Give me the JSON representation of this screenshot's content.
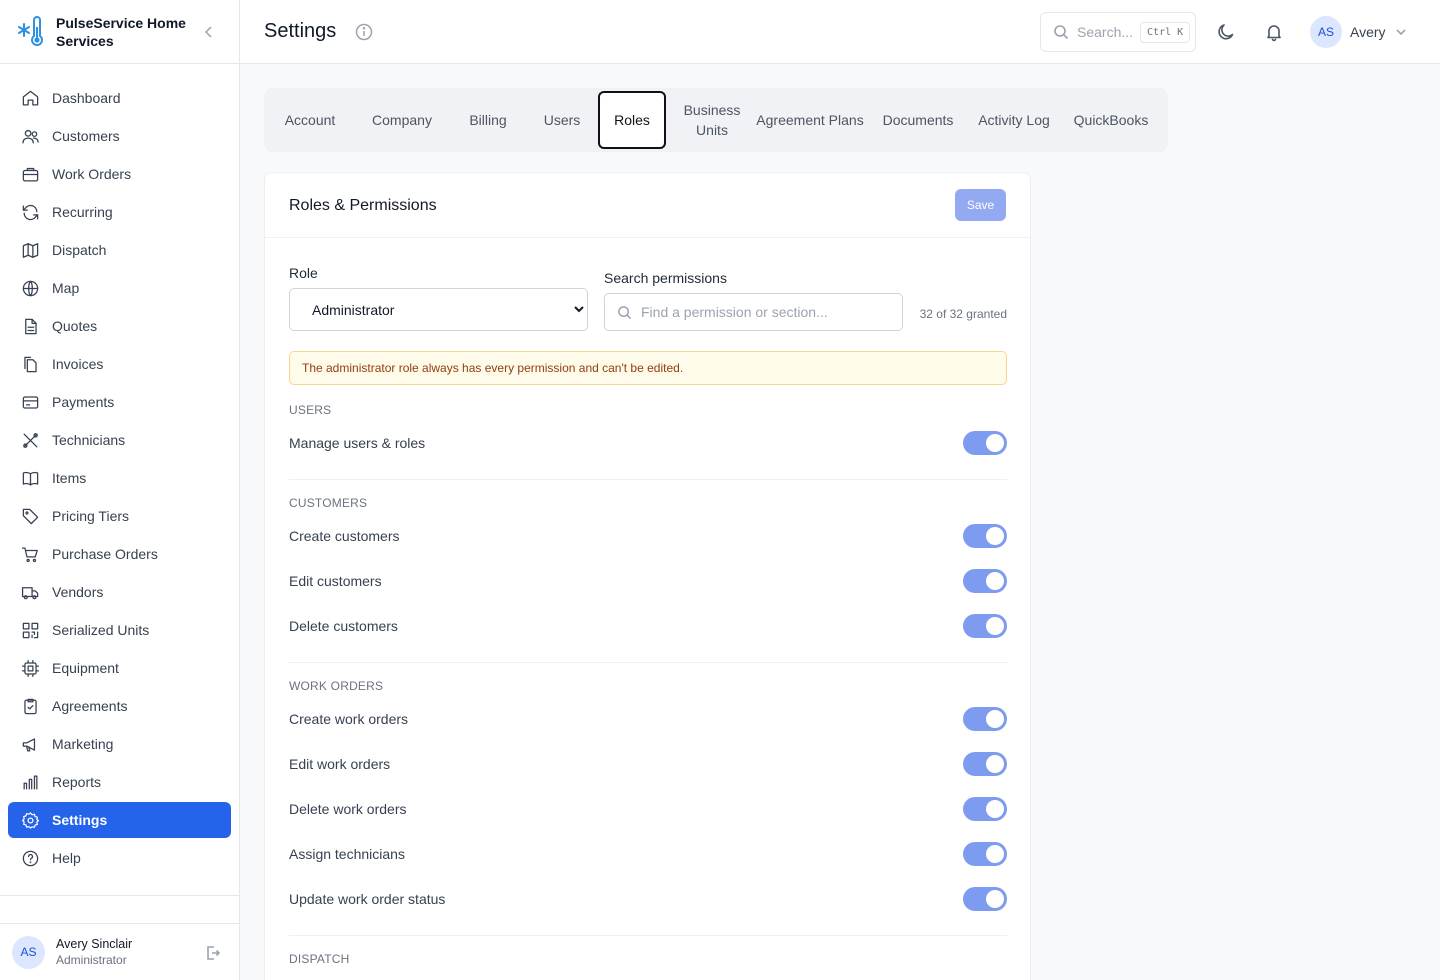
{
  "brand": {
    "name": "PulseService Home Services"
  },
  "sidebar": {
    "items": [
      {
        "label": "Dashboard",
        "icon": "home-icon"
      },
      {
        "label": "Customers",
        "icon": "users-icon"
      },
      {
        "label": "Work Orders",
        "icon": "briefcase-icon"
      },
      {
        "label": "Recurring",
        "icon": "refresh-icon"
      },
      {
        "label": "Dispatch",
        "icon": "map-fold-icon"
      },
      {
        "label": "Map",
        "icon": "globe-icon"
      },
      {
        "label": "Quotes",
        "icon": "file-text-icon"
      },
      {
        "label": "Invoices",
        "icon": "files-icon"
      },
      {
        "label": "Payments",
        "icon": "credit-card-icon"
      },
      {
        "label": "Technicians",
        "icon": "tools-icon"
      },
      {
        "label": "Items",
        "icon": "book-open-icon"
      },
      {
        "label": "Pricing Tiers",
        "icon": "tag-icon"
      },
      {
        "label": "Purchase Orders",
        "icon": "cart-icon"
      },
      {
        "label": "Vendors",
        "icon": "truck-icon"
      },
      {
        "label": "Serialized Units",
        "icon": "qr-code-icon"
      },
      {
        "label": "Equipment",
        "icon": "cpu-icon"
      },
      {
        "label": "Agreements",
        "icon": "clipboard-icon"
      },
      {
        "label": "Marketing",
        "icon": "megaphone-icon"
      },
      {
        "label": "Reports",
        "icon": "bar-chart-icon"
      },
      {
        "label": "Settings",
        "icon": "gear-icon",
        "active": true
      },
      {
        "label": "Help",
        "icon": "help-circle-icon"
      }
    ],
    "user": {
      "initials": "AS",
      "name": "Avery Sinclair",
      "role": "Administrator"
    }
  },
  "header": {
    "title": "Settings",
    "search_placeholder": "Search...",
    "shortcut": "Ctrl K",
    "user_initials": "AS",
    "user_name": "Avery"
  },
  "tabs": [
    {
      "label": "Account"
    },
    {
      "label": "Company"
    },
    {
      "label": "Billing"
    },
    {
      "label": "Users"
    },
    {
      "label": "Roles",
      "active": true
    },
    {
      "label": "Business Units"
    },
    {
      "label": "Agreement Plans"
    },
    {
      "label": "Documents"
    },
    {
      "label": "Activity Log"
    },
    {
      "label": "QuickBooks"
    }
  ],
  "roles": {
    "title": "Roles & Permissions",
    "save_label": "Save",
    "role_label": "Role",
    "role_value": "Administrator",
    "search_label": "Search permissions",
    "search_placeholder": "Find a permission or section...",
    "granted": "32 of 32 granted",
    "notice": "The administrator role always has every permission and can't be edited.",
    "sections": [
      {
        "title": "USERS",
        "permissions": [
          {
            "label": "Manage users & roles",
            "enabled": true
          }
        ]
      },
      {
        "title": "CUSTOMERS",
        "permissions": [
          {
            "label": "Create customers",
            "enabled": true
          },
          {
            "label": "Edit customers",
            "enabled": true
          },
          {
            "label": "Delete customers",
            "enabled": true
          }
        ]
      },
      {
        "title": "WORK ORDERS",
        "permissions": [
          {
            "label": "Create work orders",
            "enabled": true
          },
          {
            "label": "Edit work orders",
            "enabled": true
          },
          {
            "label": "Delete work orders",
            "enabled": true
          },
          {
            "label": "Assign technicians",
            "enabled": true
          },
          {
            "label": "Update work order status",
            "enabled": true
          }
        ]
      },
      {
        "title": "DISPATCH",
        "permissions": []
      }
    ]
  },
  "colors": {
    "accent": "#2563eb",
    "toggle_on": "#7d9cf0",
    "save_disabled": "#93a9f2",
    "notice_bg": "#fefbea",
    "notice_text": "#92400e"
  }
}
